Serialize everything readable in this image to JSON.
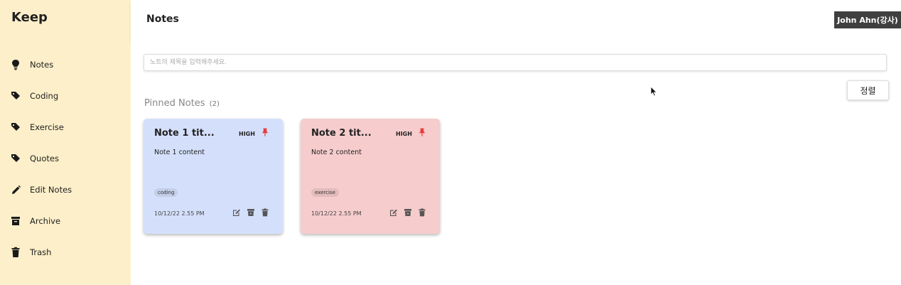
{
  "app": {
    "title": "Keep"
  },
  "sidebar": {
    "items": [
      {
        "label": "Notes",
        "icon": "lightbulb-icon"
      },
      {
        "label": "Coding",
        "icon": "tag-icon"
      },
      {
        "label": "Exercise",
        "icon": "tag-icon"
      },
      {
        "label": "Quotes",
        "icon": "tag-icon"
      },
      {
        "label": "Edit Notes",
        "icon": "pencil-icon"
      },
      {
        "label": "Archive",
        "icon": "archive-icon"
      },
      {
        "label": "Trash",
        "icon": "trash-icon"
      }
    ]
  },
  "header": {
    "title": "Notes"
  },
  "search": {
    "placeholder": "노트의 제목을 입력해주세요.",
    "value": ""
  },
  "sort": {
    "label": "정렬"
  },
  "pinned": {
    "title": "Pinned Notes",
    "count": "(2)",
    "notes": [
      {
        "title": "Note 1 tit...",
        "priority": "HIGH",
        "content": "Note 1 content",
        "tag": "coding",
        "date": "10/12/22 2.55 PM",
        "color": "#d4e0fb"
      },
      {
        "title": "Note 2 tit...",
        "priority": "HIGH",
        "content": "Note 2 content",
        "tag": "exercise",
        "date": "10/12/22 2.55 PM",
        "color": "#f6cccd"
      }
    ]
  },
  "video_overlay": {
    "name": "John Ahn(강사)"
  },
  "colors": {
    "sidebar_bg": "#fcefc9",
    "pin_red": "#e63a3a",
    "note_blue": "#d4e0fb",
    "note_pink": "#f6cccd"
  }
}
